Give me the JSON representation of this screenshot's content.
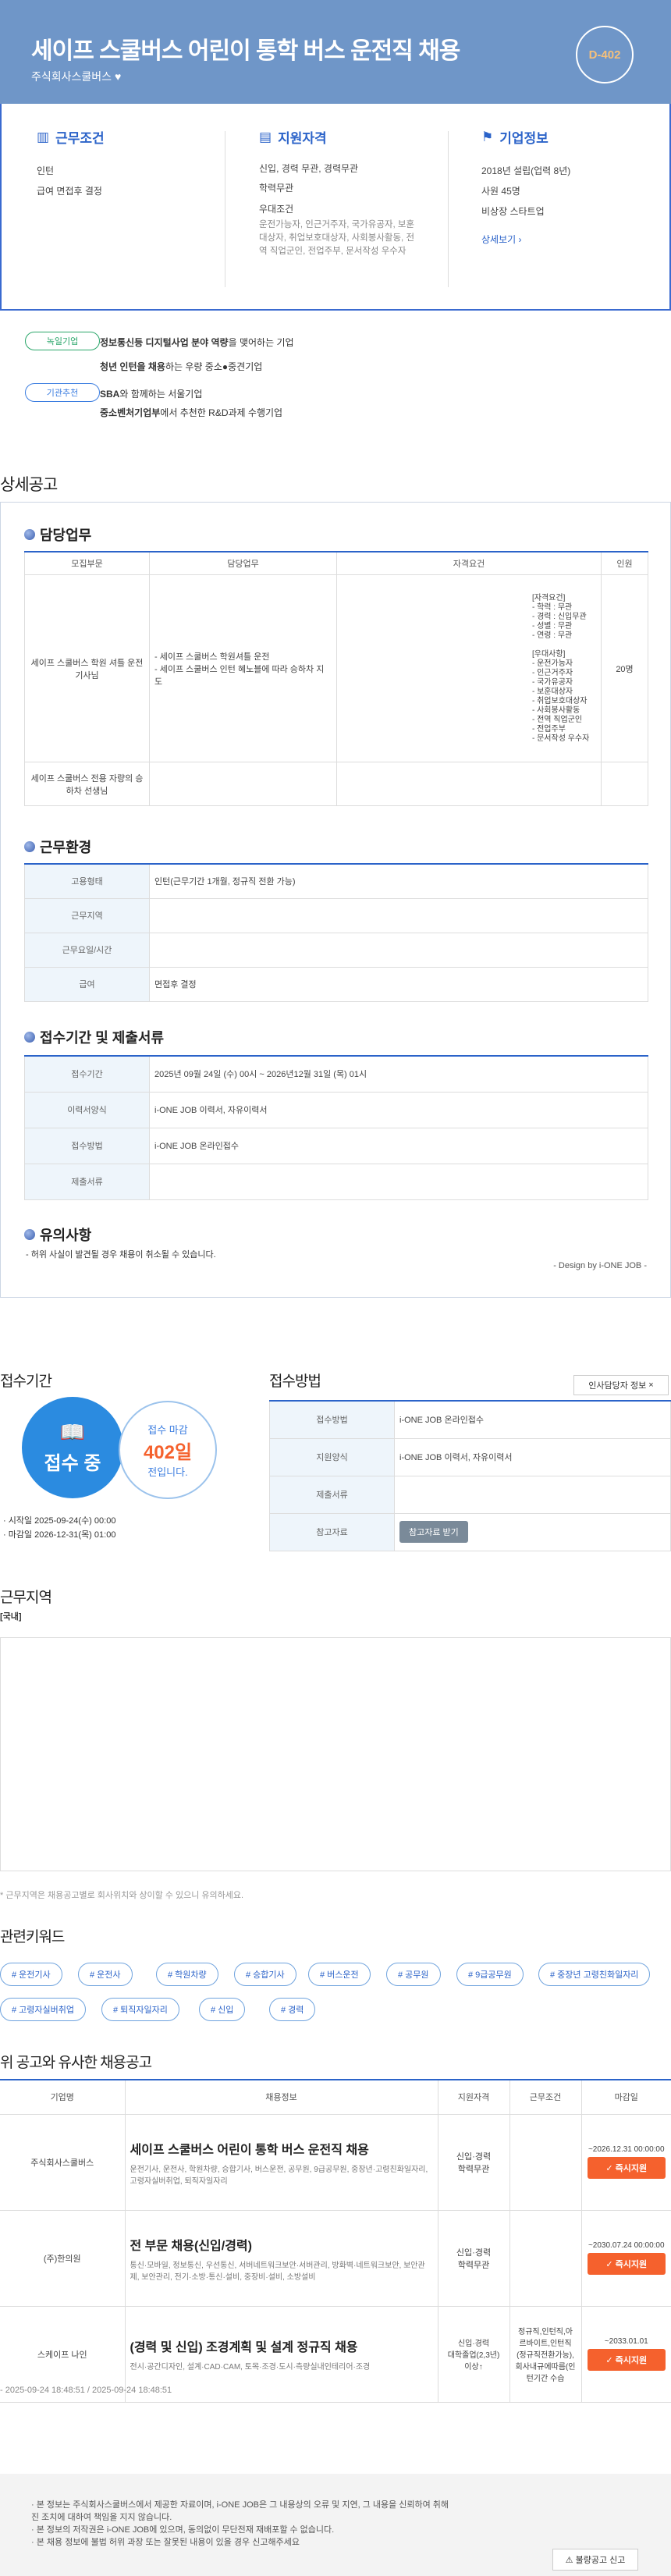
{
  "header": {
    "title": "세이프 스쿨버스 어린이 통학 버스 운전직 채용",
    "company": "주식회사스쿨버스",
    "dday": "D-402"
  },
  "summary": {
    "conditions": {
      "title": "근무조건",
      "items": [
        "인턴",
        "급여 면접후 결정"
      ]
    },
    "qualifications": {
      "title": "지원자격",
      "items": [
        "신입, 경력 무관, 경력무관",
        "학력무관"
      ],
      "pref_label": "우대조건",
      "pref": "운전가능자, 인근거주자, 국가유공자, 보훈대상자, 취업보호대상자, 사회봉사활동, 전역 직업군인, 전업주부, 문서작성 우수자"
    },
    "company": {
      "title": "기업정보",
      "items": [
        "2018년 설립(업력 8년)",
        "사원 45명",
        "비상장 스타트업"
      ],
      "more": "상세보기 ›"
    }
  },
  "tags": [
    {
      "label": "녹일기업",
      "text1": "정보통신등 디지털사업 분야 역량",
      "text2": "을 맺어하는 기업",
      "color": "#2aa66a"
    },
    {
      "label": "",
      "text1": "청년 인턴을 채용",
      "text2": "하는 우량 중소●중견기업",
      "color": ""
    },
    {
      "label": "기관추천",
      "text1": "SBA",
      "text2": "와 함께하는 서울기업",
      "color": "#3b7de0"
    },
    {
      "label": "",
      "text1": "중소벤처기업부",
      "text2": "에서 추천한 R&D과제 수행기업",
      "color": ""
    }
  ],
  "detail": {
    "heading": "상세공고",
    "duty": {
      "title": "담당업무",
      "headers": [
        "모집부문",
        "담당업무",
        "자격요건",
        "인원"
      ],
      "row1": {
        "dept": "세이프 스쿨버스 학원 셔틀 운전기사님",
        "task": "- 세이프 스쿨버스 학원셔틀 운전\n- 세이프 스쿨버스 인턴 혜노블에 따라 승하차 지도",
        "req": "[자격요건]\n- 학력 : 무관\n- 경력 : 신입무관\n- 성별 : 무관\n- 연령 : 무관\n\n[우대사항]\n- 운전가능자\n- 인근거주자\n- 국가유공자\n- 보훈대상자\n- 취업보호대상자\n- 사회봉사활동\n- 전역 직업군인\n- 전업주부\n- 문서작성 우수자",
        "count": "20명"
      },
      "row2": {
        "dept": "세이프 스쿨버스 전용 자량의 승하차 선생님"
      }
    },
    "env": {
      "title": "근무환경",
      "rows": [
        [
          "고용형태",
          "인턴(근무기간 1개월, 정규직 전환 가능)"
        ],
        [
          "근무지역",
          ""
        ],
        [
          "근무요일/시간",
          ""
        ],
        [
          "급여",
          "면접후 결정"
        ]
      ]
    },
    "apply": {
      "title": "접수기간 및 제출서류",
      "rows": [
        [
          "접수기간",
          "2025년 09월 24일 (수) 00시 ~ 2026년12월 31일 (목) 01시"
        ],
        [
          "이력서양식",
          "i-ONE JOB 이력서, 자유이력서"
        ],
        [
          "접수방법",
          "i-ONE JOB 온라인접수"
        ],
        [
          "제출서류",
          ""
        ]
      ]
    },
    "notice": {
      "title": "유의사항",
      "text": "- 허위 사실이 발견될 경우 채용이 취소될 수 있습니다.",
      "design": "- Design by i-ONE JOB -"
    }
  },
  "period": {
    "heading": "접수기간",
    "status": "접수 중",
    "deadline_label": "접수 마감",
    "deadline_days": "402일",
    "deadline_suffix": "전입니다.",
    "start": "· 시작일 2025-09-24(수) 00:00",
    "end": "· 마감일 2026-12-31(목) 01:00"
  },
  "method": {
    "heading": "접수방법",
    "manager_button": "인사담당자 정보",
    "rows": [
      [
        "접수방법",
        "i-ONE JOB 온라인접수"
      ],
      [
        "지원양식",
        "i-ONE JOB 이력서, 자유이력서"
      ],
      [
        "제출서류",
        ""
      ],
      [
        "참고자료",
        ""
      ]
    ],
    "ref_button": "참고자료 받기"
  },
  "location": {
    "heading": "근무지역",
    "address": "[국내]",
    "note": "* 근무지역은 채용공고별로 회사위치와 상이할 수 있으니 유의하세요."
  },
  "keywords": {
    "heading": "관련키워드",
    "items": [
      "# 운전기사",
      "# 운전사",
      "# 학원차량",
      "# 승합기사",
      "# 버스운전",
      "# 공무원",
      "# 9급공무원",
      "# 중장년 고령친화일자리",
      "# 고령자실버취업",
      "# 퇴직자일자리",
      "# 신입",
      "# 경력"
    ]
  },
  "similar": {
    "heading": "위 공고와 유사한 채용공고",
    "headers": [
      "기업명",
      "채용정보",
      "지원자격",
      "근무조건",
      "마감일"
    ],
    "rows": [
      {
        "company": "주식회사스쿨버스",
        "title": "세이프 스쿨버스 어린이 통학 버스 운전직 채용",
        "desc": "운전기사, 운전사, 학원차량, 승합기사, 버스운전, 공무원, 9급공무원, 중장년·고령친화일자리, 고령자실버취업, 퇴직자일자리",
        "qual": "신입·경력\n학력무관",
        "cond": "",
        "date": "~2026.12.31 00:00:00",
        "btn": "✓ 즉시지원"
      },
      {
        "company": "(주)한의원",
        "title": "전 부문 채용(신입/경력)",
        "desc": "통신·모바일, 정보통신, 우선통신, 서버네트워크보안·서버관리, 방화벽·네트워크보안, 보안관제, 보안관리, 전기·소방·통신·설비, 중장비·설비, 소방설비",
        "qual": "신입·경력\n학력무관",
        "cond": "",
        "date": "~2030.07.24 00:00:00",
        "btn": "✓ 즉시지원"
      },
      {
        "company": "스케이프 나인",
        "title": "(경력 및 신입) 조경계획 및 설계 정규직 채용",
        "desc": "전시·공간디자인, 설계·CAD·CAM, 토목·조경·도시·측량실내인테리어·조경",
        "qual": "신입·경력\n대학졸업(2,3년)\n이상↑",
        "cond": "정규직,인턴직,아르바이트,인턴직(정규직전환가능),회사내규에따름(인턴기간 수습",
        "date": "~2033.01.01",
        "btn": "✓ 즉시지원"
      }
    ]
  },
  "timestamp": "- 2025-09-24 18:48:51 / 2025-09-24 18:48:51",
  "footer": {
    "lines": [
      "· 본 정보는 주식회사스쿨버스에서 제공한 자료이며, i-ONE JOB은 그 내용상의 오류 및 지연, 그 내용을 신뢰하여 취해진 조치에 대하여 책임을 지지 않습니다.",
      "· 본 정보의 저작권은 i-ONE JOB에 있으며, 동의없이 무단전재 재배포할 수 없습니다.",
      "· 본 채용 정보에 불법 허위 과장 또는 잘못된 내용이 있을 경우 신고해주세요"
    ],
    "report": "불량공고 신고"
  }
}
